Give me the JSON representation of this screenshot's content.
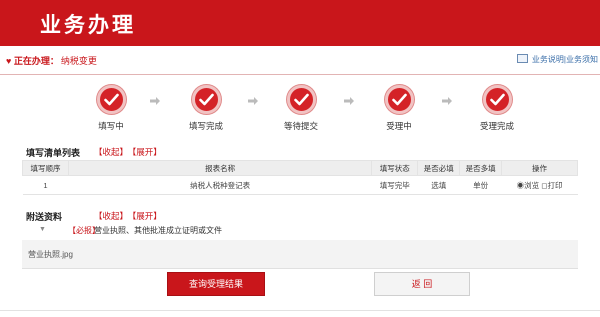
{
  "header": {
    "title": "业务办理"
  },
  "subbar": {
    "doing_label": "正在办理：",
    "doing_value": "纳税变更",
    "right_link": "业务说明|业务须知"
  },
  "steps": [
    {
      "label": "填写中"
    },
    {
      "label": "填写完成"
    },
    {
      "label": "等待提交"
    },
    {
      "label": "受理中"
    },
    {
      "label": "受理完成"
    }
  ],
  "fill_list": {
    "title": "填写清单列表",
    "collapse": "【收起】",
    "expand": "【展开】",
    "columns": [
      "填写顺序",
      "报表名称",
      "填写状态",
      "是否必填",
      "是否多填",
      "操作"
    ],
    "rows": [
      {
        "order": "1",
        "name": "纳税人税种登记表",
        "status": "填写完毕",
        "required": "选填",
        "multi": "单份",
        "op": "◉浏览  ◻打印"
      }
    ]
  },
  "attachments": {
    "title": "附送资料",
    "collapse": "【收起】",
    "expand": "【展开】",
    "item_must": "【必报】",
    "item_name": "营业执照、其他批准成立证明或文件",
    "file_name": "营业执照.jpg"
  },
  "buttons": {
    "query": "查询受理结果",
    "back": "返 回"
  }
}
